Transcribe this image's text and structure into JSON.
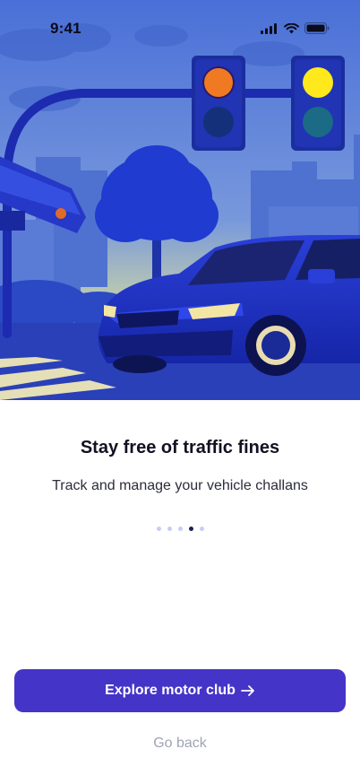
{
  "status_bar": {
    "time": "9:41"
  },
  "onboarding": {
    "title": "Stay free of traffic fines",
    "subtitle": "Track and manage your vehicle challans",
    "page_count": 5,
    "active_page": 4
  },
  "actions": {
    "primary_label": "Explore motor club",
    "secondary_label": "Go back"
  },
  "colors": {
    "primary": "#4534c8",
    "dot_active": "#1b1f55",
    "dot_inactive": "#c7cdf3"
  }
}
